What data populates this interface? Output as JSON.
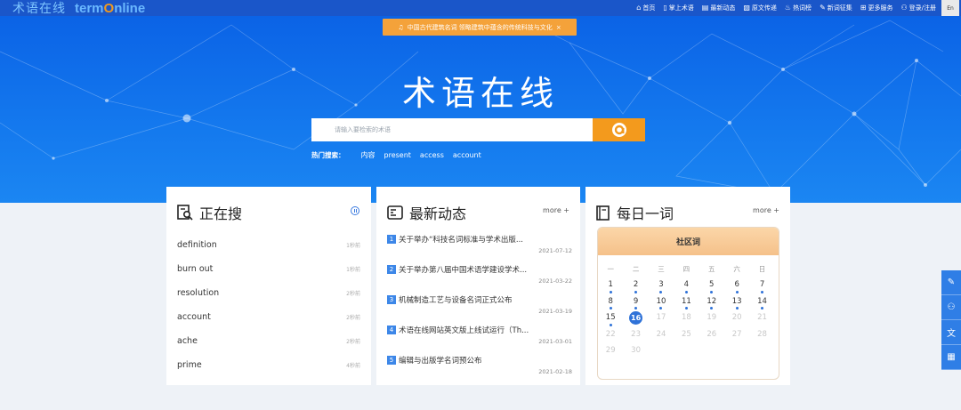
{
  "app": {
    "logo_cn": "术语在线",
    "logo_en_prefix": "term",
    "logo_en_o": "O",
    "logo_en_suffix": "nline"
  },
  "nav": {
    "items": [
      {
        "icon": "home-icon",
        "label": "首页"
      },
      {
        "icon": "phone-icon",
        "label": "掌上术语"
      },
      {
        "icon": "news-icon",
        "label": "最新动态"
      },
      {
        "icon": "document-icon",
        "label": "原文传递"
      },
      {
        "icon": "fire-icon",
        "label": "热词榜"
      },
      {
        "icon": "edit-icon",
        "label": "新词征集"
      },
      {
        "icon": "grid-icon",
        "label": "更多服务"
      },
      {
        "icon": "user-icon",
        "label": "登录/注册"
      }
    ],
    "lang": "En"
  },
  "notice": {
    "text": "中国古代建筑名词 领略建筑中蕴含的传统科技与文化",
    "close": "×"
  },
  "hero": {
    "title": "术语在线"
  },
  "search": {
    "placeholder": "请输入要检索的术语"
  },
  "hot": {
    "label": "热门搜索：",
    "keywords": [
      "内容",
      "present",
      "access",
      "account"
    ]
  },
  "searching": {
    "title": "正在搜",
    "items": [
      {
        "term": "definition",
        "time": "1秒前"
      },
      {
        "term": "burn out",
        "time": "1秒前"
      },
      {
        "term": "resolution",
        "time": "2秒前"
      },
      {
        "term": "account",
        "time": "2秒前"
      },
      {
        "term": "ache",
        "time": "2秒前"
      },
      {
        "term": "prime",
        "time": "4秒前"
      }
    ]
  },
  "news": {
    "title": "最新动态",
    "more": "more +",
    "items": [
      {
        "num": "1",
        "title": "关于举办“科技名词标准与学术出版...",
        "date": "2021-07-12"
      },
      {
        "num": "2",
        "title": "关于举办第八届中国术语学建设学术...",
        "date": "2021-03-22"
      },
      {
        "num": "3",
        "title": "机械制造工艺与设备名词正式公布",
        "date": "2021-03-19"
      },
      {
        "num": "4",
        "title": "术语在线网站英文版上线试运行（Th...",
        "date": "2021-03-01"
      },
      {
        "num": "5",
        "title": "编辑与出版学名词预公布",
        "date": "2021-02-18"
      }
    ]
  },
  "daily": {
    "title": "每日一词",
    "more": "more +",
    "calendar_title": "社区词",
    "weekdays": [
      "一",
      "二",
      "三",
      "四",
      "五",
      "六",
      "日"
    ],
    "weeks": [
      [
        "1",
        "2",
        "3",
        "4",
        "5",
        "6",
        "7"
      ],
      [
        "8",
        "9",
        "10",
        "11",
        "12",
        "13",
        "14"
      ],
      [
        "15",
        "16",
        "17",
        "18",
        "19",
        "20",
        "21"
      ],
      [
        "22",
        "23",
        "24",
        "25",
        "26",
        "27",
        "28"
      ],
      [
        "29",
        "30",
        "",
        "",
        "",
        "",
        ""
      ]
    ],
    "today": "16"
  },
  "colors": {
    "primary": "#1a56c9",
    "accent": "#f39a1d",
    "link_blue": "#3d87e8"
  }
}
